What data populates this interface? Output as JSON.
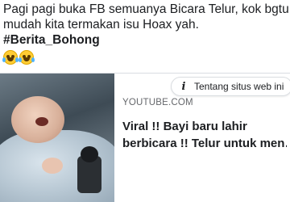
{
  "post": {
    "line1": "Pagi pagi buka FB semuanya Bicara Telur, kok bgtu",
    "line2": "mudah kita termakan isu Hoax yah.",
    "hashtag": "#Berita_Bohong",
    "emojis": [
      "face-with-tears-of-joy-icon",
      "face-with-tears-of-joy-icon"
    ]
  },
  "link_card": {
    "info_button_label": "Tentang situs web ini",
    "domain": "YOUTUBE.COM",
    "title_line1": "Viral !! Bayi baru lahir",
    "title_line2": "berbicara !! Telur untuk men…"
  },
  "colors": {
    "text": "#1c1e21",
    "secondary_text": "#65676b",
    "border": "#dadde1"
  }
}
